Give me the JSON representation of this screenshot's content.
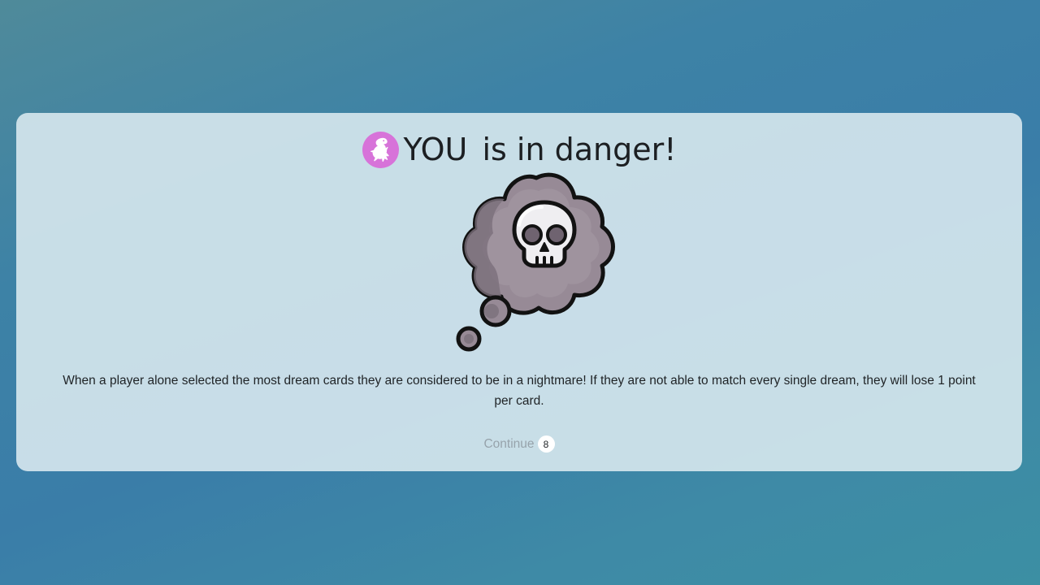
{
  "dialog": {
    "player_name": "YOU",
    "title_suffix": " is in danger!",
    "avatar_icon": "dinosaur-icon",
    "avatar_color": "#d773d9",
    "illustration_icon": "skull-thought-bubble-icon",
    "message": "When a player alone selected the most dream cards they are considered to be in a nightmare! If they are not able to match every single dream, they will lose 1 point per card.",
    "continue_label": "Continue",
    "continue_countdown": "8"
  }
}
